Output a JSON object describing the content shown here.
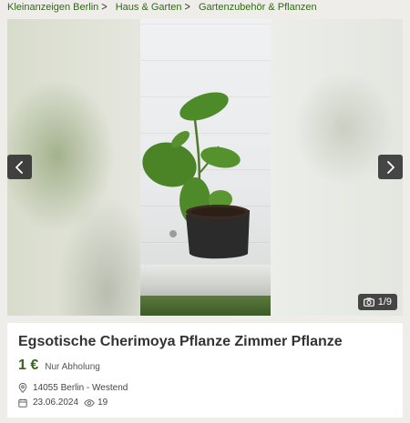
{
  "breadcrumb": [
    {
      "label": "Kleinanzeigen Berlin"
    },
    {
      "label": "Haus & Garten"
    },
    {
      "label": "Gartenzubehör & Pflanzen"
    }
  ],
  "gallery": {
    "counter": "1/9",
    "icons": {
      "prev": "chevron-left-icon",
      "next": "chevron-right-icon",
      "counter": "camera-icon"
    }
  },
  "listing": {
    "title": "Egsotische Cherimoya Pflanze Zimmer Pflanze",
    "price": "1 €",
    "price_note": "Nur Abholung",
    "location": "14055 Berlin - Westend",
    "date": "23.06.2024",
    "views": "19"
  },
  "colors": {
    "accent": "#326916",
    "background": "#efede9"
  }
}
